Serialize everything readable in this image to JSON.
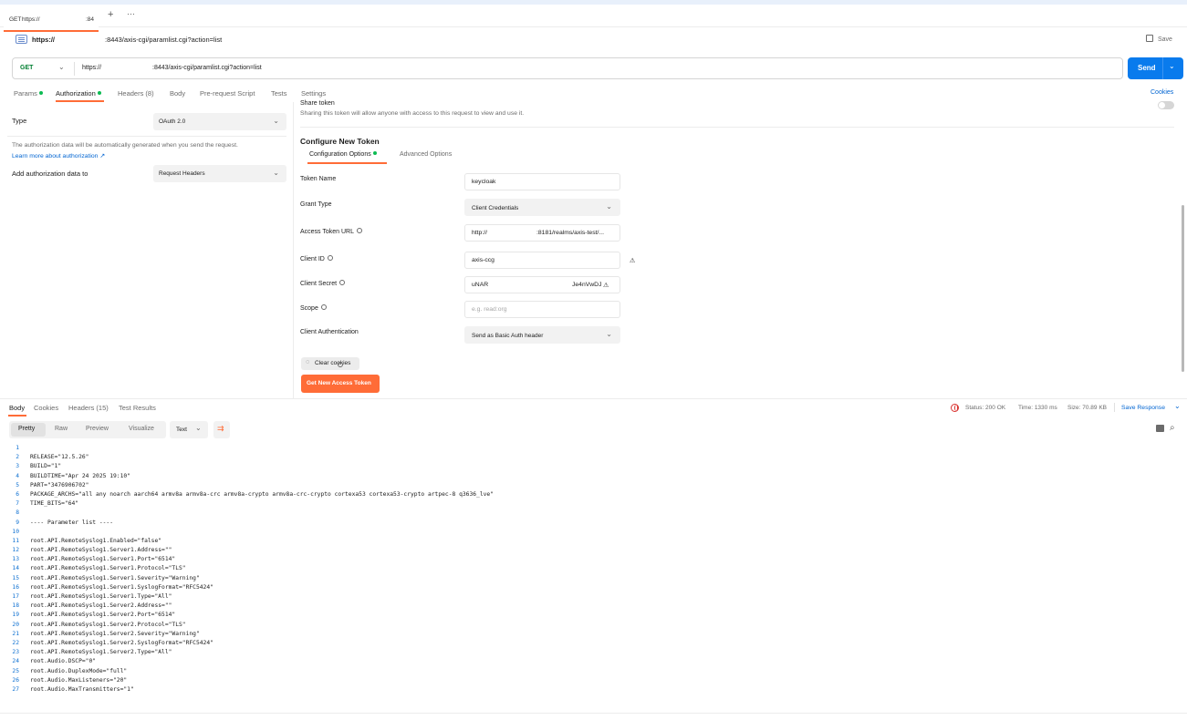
{
  "tab": {
    "method": "GET",
    "title": "https://",
    "suffix": ":84"
  },
  "breadcrumb": {
    "host": "https://",
    "path": ":8443/axis-cgi/paramlist.cgi?action=list",
    "save": "Save"
  },
  "request": {
    "method": "GET",
    "url_host": "https://",
    "url_path": ":8443/axis-cgi/paramlist.cgi?action=list",
    "send": "Send"
  },
  "req_tabs": [
    "Params",
    "Authorization",
    "Headers (8)",
    "Body",
    "Pre-request Script",
    "Tests",
    "Settings"
  ],
  "cookies_link": "Cookies",
  "auth": {
    "type_label": "Type",
    "type_value": "OAuth 2.0",
    "note": "The authorization data will be automatically generated when you send the request.",
    "learn_more": "Learn more about authorization ↗",
    "add_label": "Add authorization data to",
    "add_value": "Request Headers"
  },
  "share": {
    "title": "Share token",
    "desc": "Sharing this token will allow anyone with access to this request to view and use it."
  },
  "configure": {
    "heading": "Configure New Token",
    "tabs": [
      "Configuration Options",
      "Advanced Options"
    ],
    "fields": {
      "token_name": {
        "label": "Token Name",
        "value": "keycloak"
      },
      "grant_type": {
        "label": "Grant Type",
        "value": "Client Credentials"
      },
      "access_token_url": {
        "label": "Access Token URL",
        "value_a": "http://",
        "value_b": ":8181/realms/axis-test/..."
      },
      "client_id": {
        "label": "Client ID",
        "value": "axis-ccg"
      },
      "client_secret": {
        "label": "Client Secret",
        "value_a": "uNAR",
        "value_b": "Je4nVwDJ"
      },
      "scope": {
        "label": "Scope",
        "placeholder": "e.g. read:org"
      },
      "client_auth": {
        "label": "Client Authentication",
        "value": "Send as Basic Auth header"
      }
    },
    "clear_cookies": "Clear cookies",
    "get_token": "Get New Access Token"
  },
  "response": {
    "tabs": [
      "Body",
      "Cookies",
      "Headers (15)",
      "Test Results"
    ],
    "status": "Status: 200 OK",
    "time": "Time: 1330 ms",
    "size": "Size: 70.89 KB",
    "save_response": "Save Response",
    "views": [
      "Pretty",
      "Raw",
      "Preview",
      "Visualize"
    ],
    "format": "Text"
  },
  "code_lines": [
    "",
    "RELEASE=\"12.5.26\"",
    "BUILD=\"1\"",
    "BUILDTIME=\"Apr 24 2025 19:10\"",
    "PART=\"3476906702\"",
    "PACKAGE_ARCHS=\"all any noarch aarch64 armv8a armv8a-crc armv8a-crypto armv8a-crc-crypto cortexa53 cortexa53-crypto artpec-8 q3636_lve\"",
    "TIME_BITS=\"64\"",
    "",
    "---- Parameter list ----",
    "",
    "root.API.RemoteSyslog1.Enabled=\"false\"",
    "root.API.RemoteSyslog1.Server1.Address=\"\"",
    "root.API.RemoteSyslog1.Server1.Port=\"6514\"",
    "root.API.RemoteSyslog1.Server1.Protocol=\"TLS\"",
    "root.API.RemoteSyslog1.Server1.Severity=\"Warning\"",
    "root.API.RemoteSyslog1.Server1.SyslogFormat=\"RFC5424\"",
    "root.API.RemoteSyslog1.Server1.Type=\"All\"",
    "root.API.RemoteSyslog1.Server2.Address=\"\"",
    "root.API.RemoteSyslog1.Server2.Port=\"6514\"",
    "root.API.RemoteSyslog1.Server2.Protocol=\"TLS\"",
    "root.API.RemoteSyslog1.Server2.Severity=\"Warning\"",
    "root.API.RemoteSyslog1.Server2.SyslogFormat=\"RFC5424\"",
    "root.API.RemoteSyslog1.Server2.Type=\"All\"",
    "root.Audio.DSCP=\"0\"",
    "root.Audio.DuplexMode=\"full\"",
    "root.Audio.MaxListeners=\"20\"",
    "root.Audio.MaxTransmitters=\"1\""
  ]
}
